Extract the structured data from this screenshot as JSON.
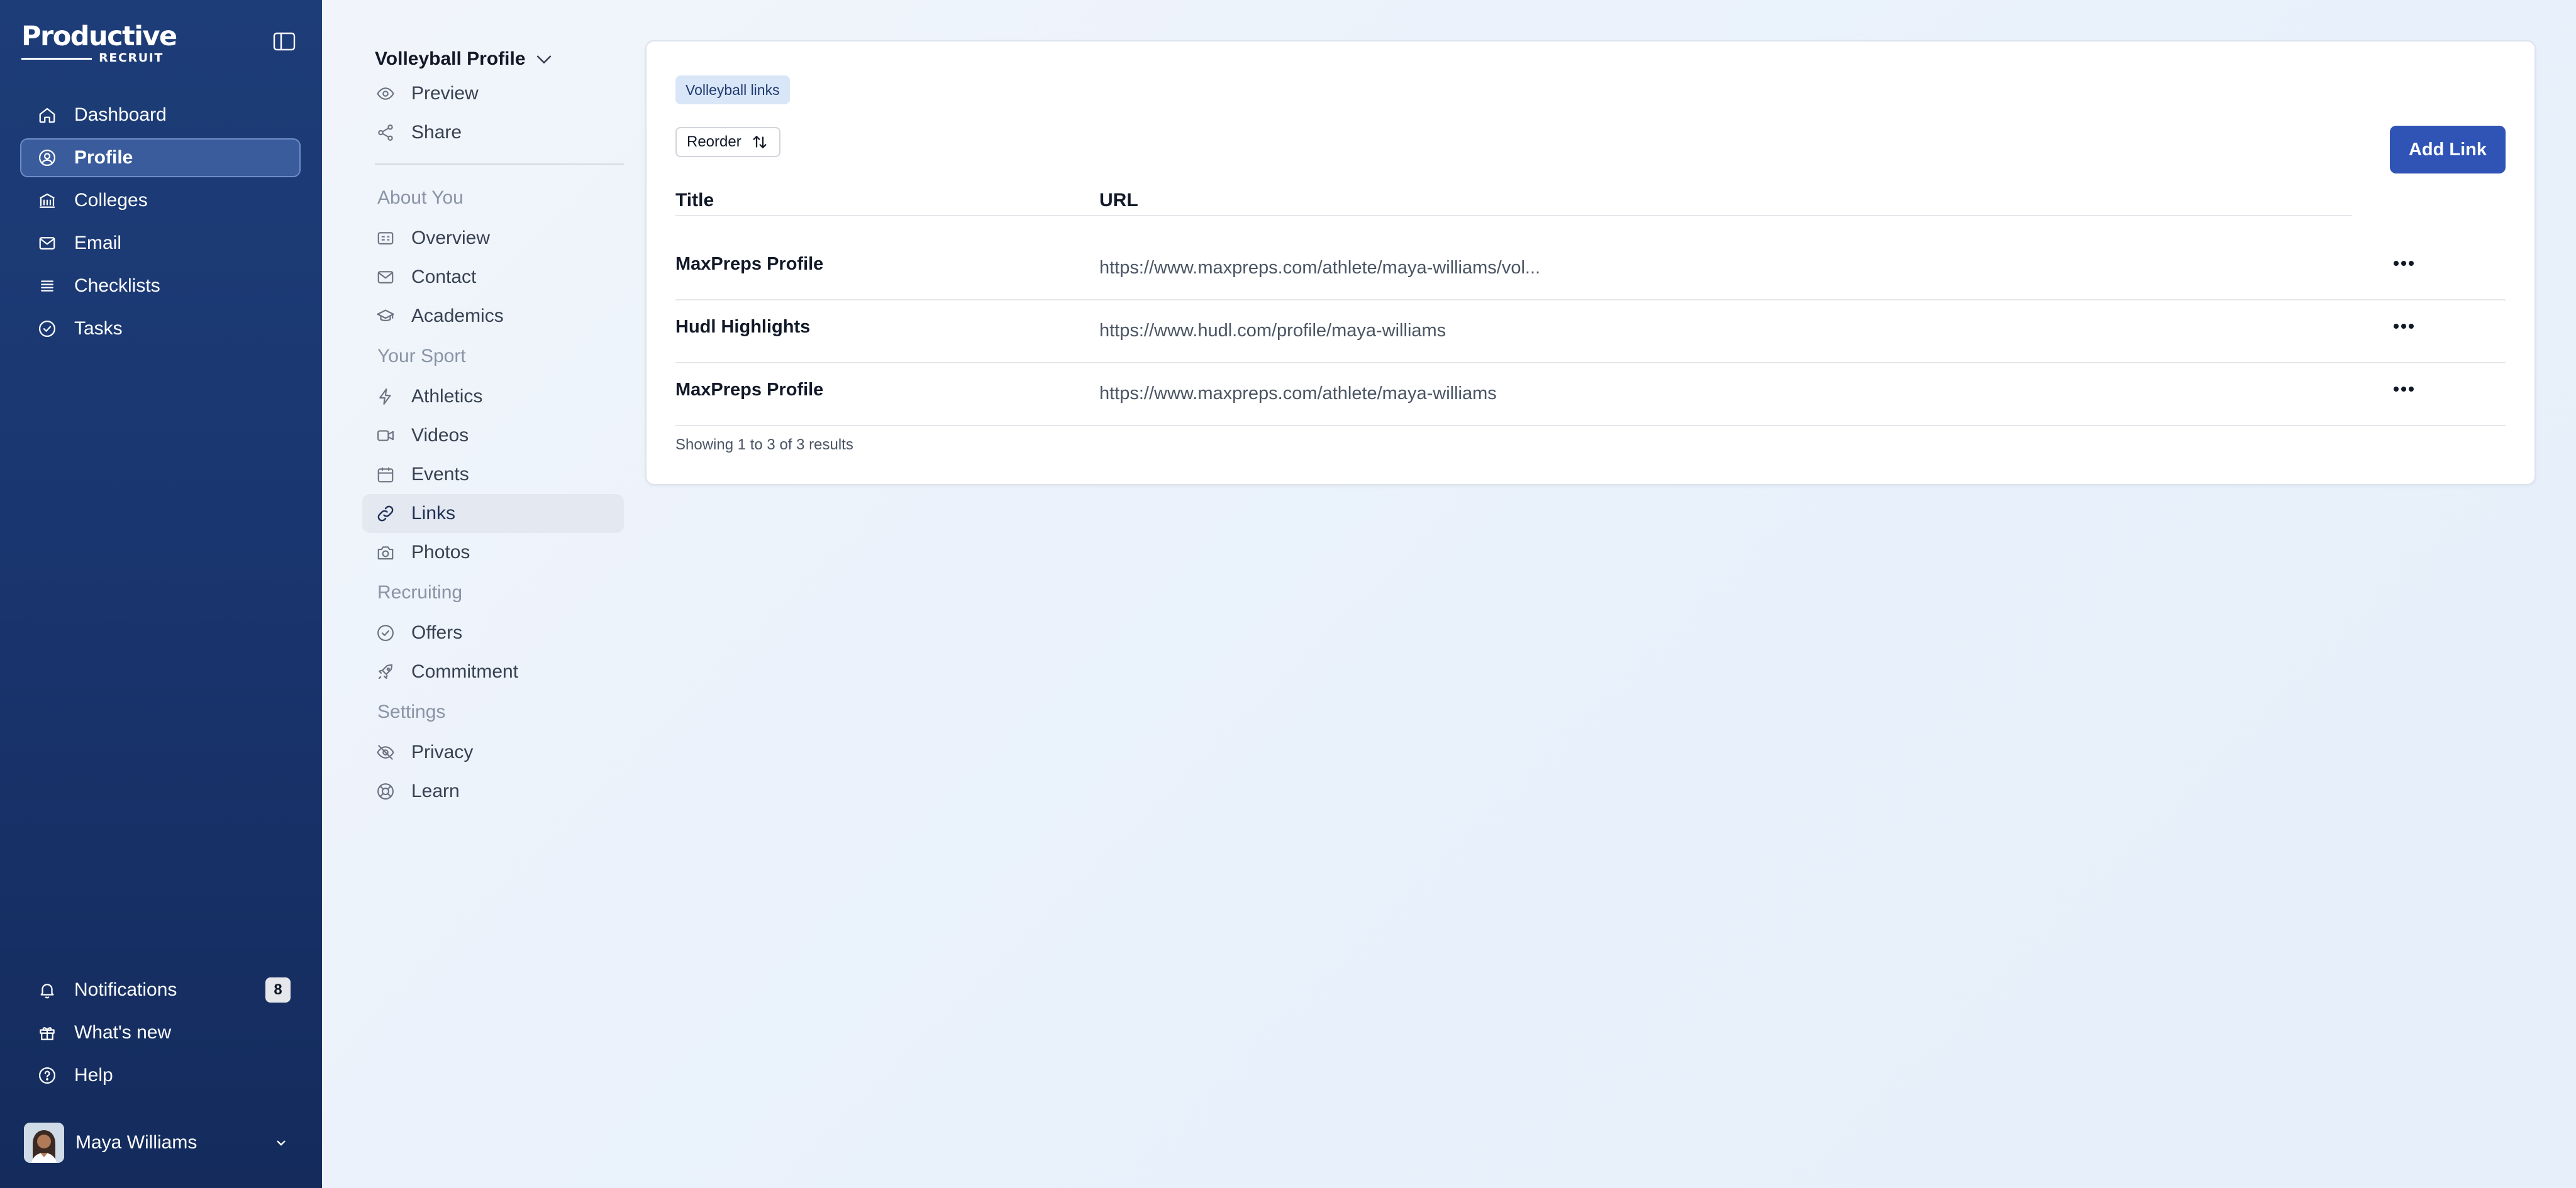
{
  "app": {
    "logo_text": "Productive",
    "logo_subtext": "RECRUIT"
  },
  "sidebar": {
    "items": [
      {
        "label": "Dashboard",
        "icon": "home-icon"
      },
      {
        "label": "Profile",
        "icon": "user-circle-icon",
        "active": true
      },
      {
        "label": "Colleges",
        "icon": "building-icon"
      },
      {
        "label": "Email",
        "icon": "mail-icon"
      },
      {
        "label": "Checklists",
        "icon": "list-icon"
      },
      {
        "label": "Tasks",
        "icon": "check-circle-icon"
      }
    ],
    "bottom_items": [
      {
        "label": "Notifications",
        "icon": "bell-icon",
        "badge": "8"
      },
      {
        "label": "What's new",
        "icon": "gift-icon"
      },
      {
        "label": "Help",
        "icon": "help-circle-icon"
      }
    ],
    "user": {
      "name": "Maya Williams"
    }
  },
  "subnav": {
    "header": "Volleyball Profile",
    "top_items": [
      {
        "label": "Preview",
        "icon": "eye-icon"
      },
      {
        "label": "Share",
        "icon": "share-icon"
      }
    ],
    "sections": [
      {
        "title": "About You",
        "items": [
          {
            "label": "Overview",
            "icon": "id-card-icon"
          },
          {
            "label": "Contact",
            "icon": "mail-icon"
          },
          {
            "label": "Academics",
            "icon": "graduation-cap-icon"
          }
        ]
      },
      {
        "title": "Your Sport",
        "items": [
          {
            "label": "Athletics",
            "icon": "bolt-icon"
          },
          {
            "label": "Videos",
            "icon": "video-icon"
          },
          {
            "label": "Events",
            "icon": "calendar-icon"
          },
          {
            "label": "Links",
            "icon": "link-icon",
            "active": true
          },
          {
            "label": "Photos",
            "icon": "camera-icon"
          }
        ]
      },
      {
        "title": "Recruiting",
        "items": [
          {
            "label": "Offers",
            "icon": "check-circle-icon"
          },
          {
            "label": "Commitment",
            "icon": "rocket-icon"
          }
        ]
      },
      {
        "title": "Settings",
        "items": [
          {
            "label": "Privacy",
            "icon": "eye-off-icon"
          },
          {
            "label": "Learn",
            "icon": "lifebuoy-icon"
          }
        ]
      }
    ]
  },
  "main": {
    "tag": "Volleyball links",
    "reorder_label": "Reorder",
    "add_label": "Add Link",
    "columns": {
      "title": "Title",
      "url": "URL"
    },
    "rows": [
      {
        "title": "MaxPreps Profile",
        "url": "https://www.maxpreps.com/athlete/maya-williams/vol..."
      },
      {
        "title": "Hudl Highlights",
        "url": "https://www.hudl.com/profile/maya-williams"
      },
      {
        "title": "MaxPreps Profile",
        "url": "https://www.maxpreps.com/athlete/maya-williams"
      }
    ],
    "results_text": "Showing 1 to 3 of 3 results"
  }
}
